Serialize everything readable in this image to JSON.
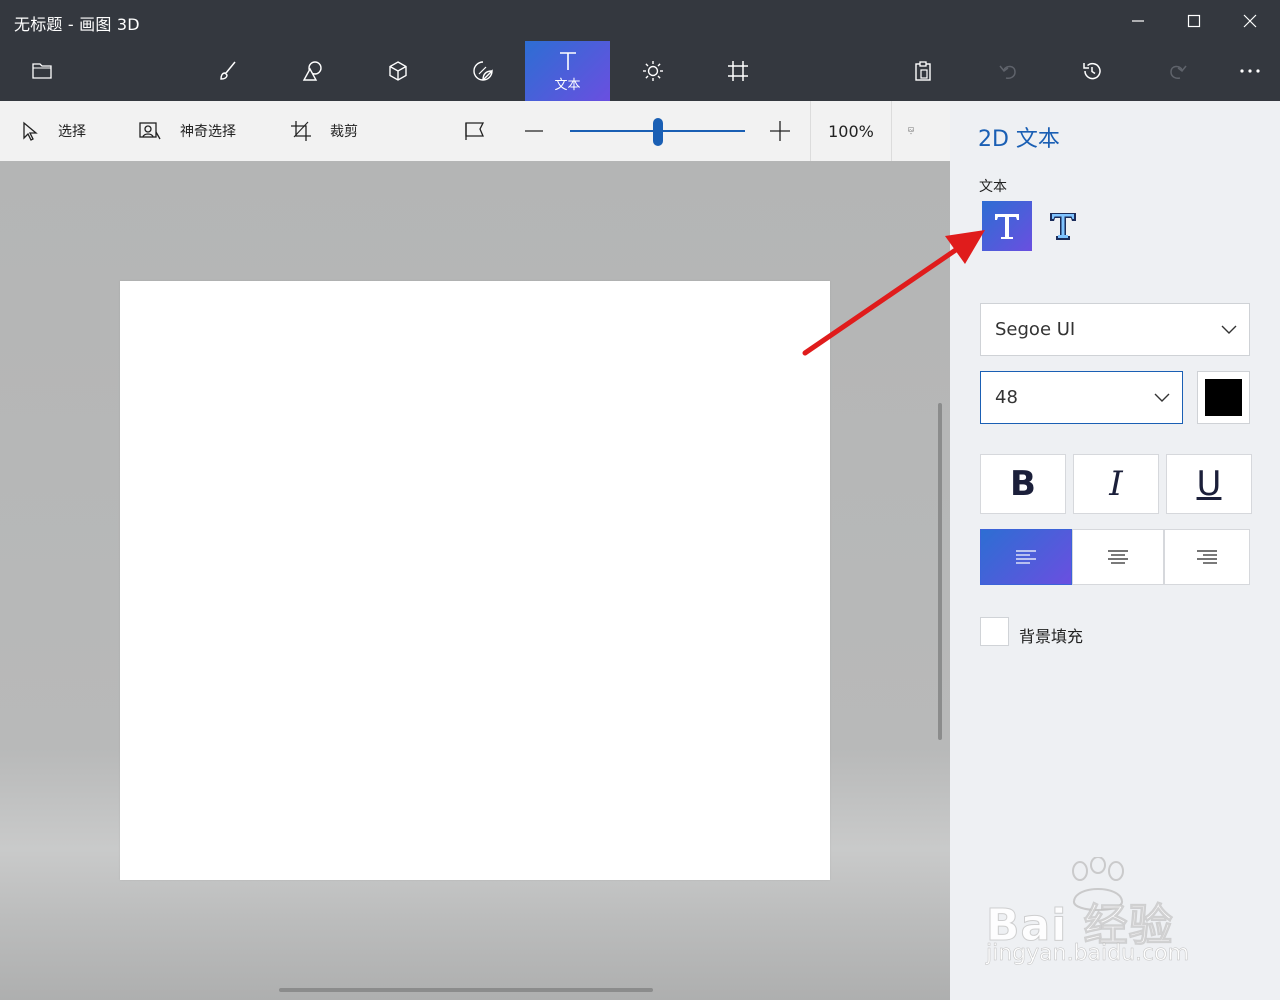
{
  "window": {
    "title": "无标题 - 画图 3D",
    "minimize_icon": "minimize-icon",
    "maximize_icon": "maximize-icon",
    "close_icon": "close-icon"
  },
  "toolbar": {
    "menu_icon": "folder-icon",
    "tools": [
      {
        "icon": "brush-icon",
        "label": ""
      },
      {
        "icon": "2d-shapes-icon",
        "label": ""
      },
      {
        "icon": "3d-shapes-icon",
        "label": ""
      },
      {
        "icon": "stickers-icon",
        "label": ""
      },
      {
        "icon": "text-icon",
        "label": "文本",
        "active": true
      },
      {
        "icon": "effects-icon",
        "label": ""
      },
      {
        "icon": "canvas-icon",
        "label": ""
      }
    ],
    "right_icons": [
      "paste-icon",
      "undo-icon",
      "history-icon",
      "redo-icon",
      "more-icon"
    ]
  },
  "subbar": {
    "select_label": "选择",
    "magic_select_label": "神奇选择",
    "crop_label": "裁剪",
    "zoom_level": 0.5,
    "zoom_text": "100%"
  },
  "panel": {
    "title": "2D 文本",
    "text_label": "文本",
    "font": "Segoe UI",
    "size": "48",
    "color": "#000000",
    "bold": "B",
    "italic": "I",
    "underline": "U",
    "background_fill_label": "背景填充",
    "active_alignment": "left"
  },
  "watermark": {
    "logo": "Bai 经验",
    "site": "jingyan.baidu.com"
  },
  "colors": {
    "accent": "#1a5fb4",
    "arrow": "#e01c1c",
    "dark_bar": "#34383f"
  }
}
